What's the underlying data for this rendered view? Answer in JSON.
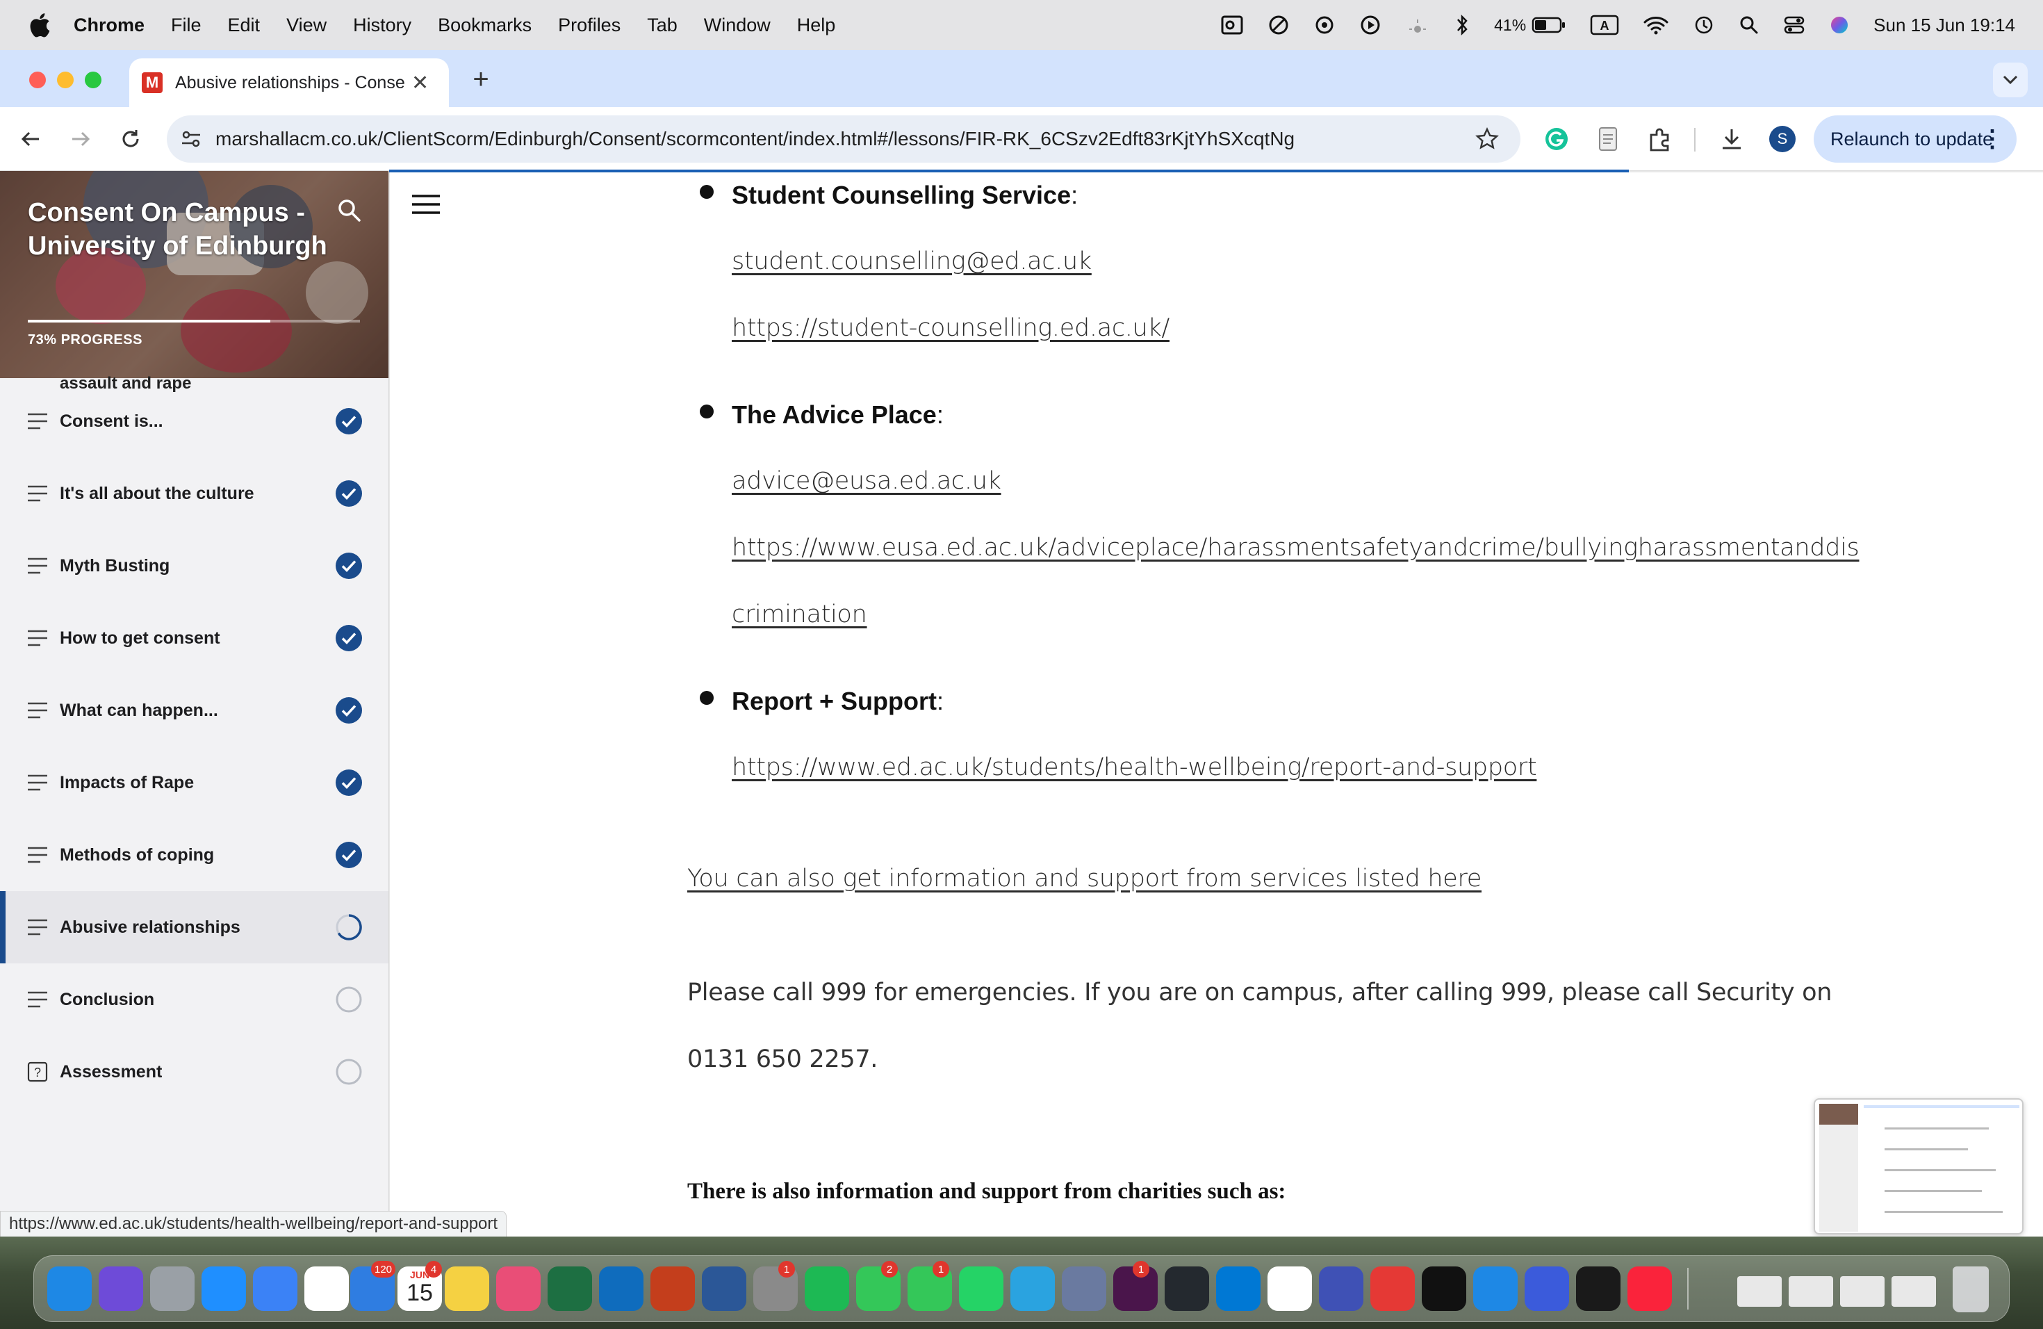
{
  "menubar": {
    "app": "Chrome",
    "items": [
      "File",
      "Edit",
      "View",
      "History",
      "Bookmarks",
      "Profiles",
      "Tab",
      "Window",
      "Help"
    ],
    "battery": "41%",
    "datetime": "Sun 15 Jun  19:14"
  },
  "browser": {
    "tab_title": "Abusive relationships - Consent On Campus",
    "tab_favicon": "M",
    "url": "marshallacm.co.uk/ClientScorm/Edinburgh/Consent/scormcontent/index.html#/lessons/FIR-RK_6CSzv2Edft83rKjtYhSXcqtNg",
    "relaunch_label": "Relaunch to update",
    "profile_initial": "S",
    "status_url": "https://www.ed.ac.uk/students/health-wellbeing/report-and-support"
  },
  "sidebar": {
    "course_title": "Consent On Campus - University of Edinburgh",
    "progress_label": "73% PROGRESS",
    "progress_value": 0.73,
    "partial_item": "assault and rape",
    "lessons": [
      {
        "name": "Consent is...",
        "status": "complete",
        "icon": "list-icon"
      },
      {
        "name": "It's all about the culture",
        "status": "complete",
        "icon": "list-icon"
      },
      {
        "name": "Myth Busting",
        "status": "complete",
        "icon": "list-icon"
      },
      {
        "name": "How to get consent",
        "status": "complete",
        "icon": "list-icon"
      },
      {
        "name": "What can happen...",
        "status": "complete",
        "icon": "list-icon"
      },
      {
        "name": "Impacts of Rape",
        "status": "complete",
        "icon": "list-icon"
      },
      {
        "name": "Methods of coping",
        "status": "complete",
        "icon": "list-icon"
      },
      {
        "name": "Abusive relationships",
        "status": "in-progress",
        "icon": "list-icon"
      },
      {
        "name": "Conclusion",
        "status": "not-started",
        "icon": "list-icon"
      },
      {
        "name": "Assessment",
        "status": "not-started",
        "icon": "quiz-icon"
      }
    ]
  },
  "content": {
    "services": [
      {
        "name": "Student Counselling Service",
        "links": [
          "student.counselling@ed.ac.uk ",
          "https://student-counselling.ed.ac.uk/"
        ]
      },
      {
        "name": "The Advice Place",
        "links": [
          "advice@eusa.ed.ac.uk",
          "https://www.eusa.ed.ac.uk/adviceplace/harassmentsafetyandcrime/bullyingharassmentanddis",
          "crimination"
        ]
      },
      {
        "name": "Report + Support",
        "links": [
          "https://www.ed.ac.uk/students/health-wellbeing/report-and-support"
        ]
      }
    ],
    "colon": ":",
    "more_info_link": "You can also get information and support from services listed here",
    "emergency_line1": "Please call 999 for emergencies. If you are on campus, after calling 999, please call Security on",
    "emergency_line2": "0131 650 2257.",
    "charities_heading": "There is also information and support from charities such as:"
  },
  "dock": {
    "badges": {
      "mail": "120",
      "calendar_month": "JUN",
      "calendar_day": "15",
      "calendar_badge": "4",
      "settings": "1",
      "messages": "2",
      "facetime": "1",
      "slack": "1"
    },
    "colors": [
      "#1e88e5",
      "#6e4bd8",
      "#9aa0a6",
      "#1f8fff",
      "#3b82f6",
      "#ffffff",
      "#2f7de1",
      "#ffffff",
      "#f5d142",
      "#e94e77",
      "#1d6f42",
      "#0f6cbd",
      "#c43e1c",
      "#2b5797",
      "#8a8a8a",
      "#1db954",
      "#34c759",
      "#34c759",
      "#25d366",
      "#2aa3e0",
      "#6a7aa0",
      "#4a154b",
      "#24292f",
      "#0078d4",
      "#ffffff",
      "#3f51b5",
      "#e53935",
      "#111111",
      "#1e88e5",
      "#3b5bdb",
      "#1a1a1a",
      "#fa233b"
    ]
  }
}
